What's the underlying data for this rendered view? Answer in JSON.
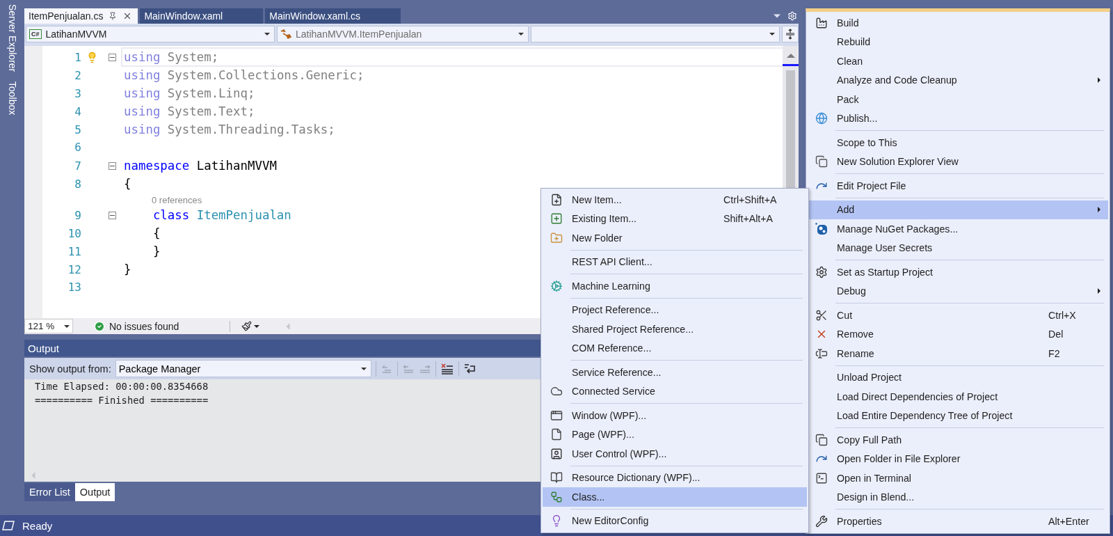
{
  "side_tabs": [
    "Server Explorer",
    "Toolbox"
  ],
  "editor": {
    "tabs": [
      {
        "label": "ItemPenjualan.cs",
        "selected": true
      },
      {
        "label": "MainWindow.xaml",
        "selected": false
      },
      {
        "label": "MainWindow.xaml.cs",
        "selected": false
      }
    ],
    "nav": {
      "project_badge": "C#",
      "project": "LatihanMVVM",
      "type": "LatihanMVVM.ItemPenjualan"
    },
    "lines": [
      {
        "number": "1",
        "fold": true,
        "current": true,
        "tokens": [
          {
            "text": "using",
            "kind": "faded-keyword"
          },
          {
            "text": " System;",
            "kind": "faded"
          }
        ]
      },
      {
        "number": "2",
        "fold": false,
        "current": false,
        "tokens": [
          {
            "text": "using",
            "kind": "faded-keyword"
          },
          {
            "text": " System.Collections.Generic;",
            "kind": "faded"
          }
        ]
      },
      {
        "number": "3",
        "fold": false,
        "current": false,
        "tokens": [
          {
            "text": "using",
            "kind": "faded-keyword"
          },
          {
            "text": " System.Linq;",
            "kind": "faded"
          }
        ]
      },
      {
        "number": "4",
        "fold": false,
        "current": false,
        "tokens": [
          {
            "text": "using",
            "kind": "faded-keyword"
          },
          {
            "text": " System.Text;",
            "kind": "faded"
          }
        ]
      },
      {
        "number": "5",
        "fold": false,
        "current": false,
        "tokens": [
          {
            "text": "using",
            "kind": "faded-keyword"
          },
          {
            "text": " System.Threading.Tasks;",
            "kind": "faded"
          }
        ]
      },
      {
        "number": "6",
        "fold": false,
        "current": false
      },
      {
        "number": "7",
        "fold": true,
        "current": false,
        "tokens": [
          {
            "text": "namespace",
            "kind": "keyword"
          },
          {
            "text": " LatihanMVVM",
            "kind": "plain"
          }
        ]
      },
      {
        "number": "8",
        "fold": false,
        "current": false,
        "tokens": [
          {
            "text": "{",
            "kind": "plain"
          }
        ]
      },
      {
        "number": "9",
        "fold": true,
        "current": false,
        "lens": "0 references",
        "tokens": [
          {
            "text": "    class",
            "kind": "keyword"
          },
          {
            "text": " ItemPenjualan",
            "kind": "type"
          }
        ]
      },
      {
        "number": "10",
        "fold": false,
        "current": false,
        "tokens": [
          {
            "text": "    {",
            "kind": "plain"
          }
        ]
      },
      {
        "number": "11",
        "fold": false,
        "current": false,
        "tokens": [
          {
            "text": "    }",
            "kind": "plain"
          }
        ]
      },
      {
        "number": "12",
        "fold": false,
        "current": false,
        "tokens": [
          {
            "text": "}",
            "kind": "plain"
          }
        ]
      },
      {
        "number": "13",
        "fold": false,
        "current": false
      }
    ],
    "zoom": "121 %",
    "issues": "No issues found"
  },
  "output": {
    "title": "Output",
    "source_label": "Show output from:",
    "source": "Package Manager",
    "lines": [
      "Time Elapsed: 00:00:00.8354668",
      "========== Finished =========="
    ],
    "tabs": [
      {
        "label": "Error List",
        "selected": false
      },
      {
        "label": "Output",
        "selected": true
      }
    ]
  },
  "status": "Ready",
  "context_menu": {
    "groups": [
      [
        {
          "label": "Build",
          "submenu": false,
          "selected": false
        },
        {
          "label": "Rebuild",
          "submenu": false,
          "selected": false
        },
        {
          "label": "Clean",
          "submenu": false,
          "selected": false
        },
        {
          "label": "Analyze and Code Cleanup",
          "submenu": true,
          "selected": false
        },
        {
          "label": "Pack",
          "submenu": false,
          "selected": false
        },
        {
          "label": "Publish...",
          "submenu": false,
          "selected": false
        }
      ],
      [
        {
          "label": "Scope to This",
          "submenu": false,
          "selected": false
        },
        {
          "label": "New Solution Explorer View",
          "submenu": false,
          "selected": false
        }
      ],
      [
        {
          "label": "Edit Project File",
          "submenu": false,
          "selected": false
        }
      ],
      [
        {
          "label": "Add",
          "submenu": true,
          "selected": true
        },
        {
          "label": "Manage NuGet Packages...",
          "submenu": false,
          "selected": false
        },
        {
          "label": "Manage User Secrets",
          "submenu": false,
          "selected": false
        }
      ],
      [
        {
          "label": "Set as Startup Project",
          "submenu": false,
          "selected": false
        },
        {
          "label": "Debug",
          "submenu": true,
          "selected": false
        }
      ],
      [
        {
          "label": "Cut",
          "shortcut": "Ctrl+X",
          "submenu": false,
          "selected": false
        },
        {
          "label": "Remove",
          "shortcut": "Del",
          "submenu": false,
          "selected": false
        },
        {
          "label": "Rename",
          "shortcut": "F2",
          "submenu": false,
          "selected": false
        }
      ],
      [
        {
          "label": "Unload Project",
          "submenu": false,
          "selected": false
        },
        {
          "label": "Load Direct Dependencies of Project",
          "submenu": false,
          "selected": false
        },
        {
          "label": "Load Entire Dependency Tree of Project",
          "submenu": false,
          "selected": false
        }
      ],
      [
        {
          "label": "Copy Full Path",
          "submenu": false,
          "selected": false
        },
        {
          "label": "Open Folder in File Explorer",
          "submenu": false,
          "selected": false
        },
        {
          "label": "Open in Terminal",
          "submenu": false,
          "selected": false
        },
        {
          "label": "Design in Blend...",
          "submenu": false,
          "selected": false
        }
      ],
      [
        {
          "label": "Properties",
          "shortcut": "Alt+Enter",
          "submenu": false,
          "selected": false
        }
      ]
    ]
  },
  "submenu": {
    "groups": [
      [
        {
          "label": "New Item...",
          "shortcut": "Ctrl+Shift+A",
          "submenu": false,
          "selected": false
        },
        {
          "label": "Existing Item...",
          "shortcut": "Shift+Alt+A",
          "submenu": false,
          "selected": false
        },
        {
          "label": "New Folder",
          "submenu": false,
          "selected": false
        }
      ],
      [
        {
          "label": "REST API Client...",
          "submenu": false,
          "selected": false
        }
      ],
      [
        {
          "label": "Machine Learning",
          "submenu": false,
          "selected": false
        }
      ],
      [
        {
          "label": "Project Reference...",
          "submenu": false,
          "selected": false
        },
        {
          "label": "Shared Project Reference...",
          "submenu": false,
          "selected": false
        },
        {
          "label": "COM Reference...",
          "submenu": false,
          "selected": false
        }
      ],
      [
        {
          "label": "Service Reference...",
          "submenu": false,
          "selected": false
        },
        {
          "label": "Connected Service",
          "submenu": false,
          "selected": false
        }
      ],
      [
        {
          "label": "Window (WPF)...",
          "submenu": false,
          "selected": false
        },
        {
          "label": "Page (WPF)...",
          "submenu": false,
          "selected": false
        },
        {
          "label": "User Control (WPF)...",
          "submenu": false,
          "selected": false
        }
      ],
      [
        {
          "label": "Resource Dictionary (WPF)...",
          "submenu": false,
          "selected": false
        },
        {
          "label": "Class...",
          "submenu": false,
          "selected": true
        }
      ],
      [
        {
          "label": "New EditorConfig",
          "submenu": false,
          "selected": false
        }
      ]
    ]
  }
}
